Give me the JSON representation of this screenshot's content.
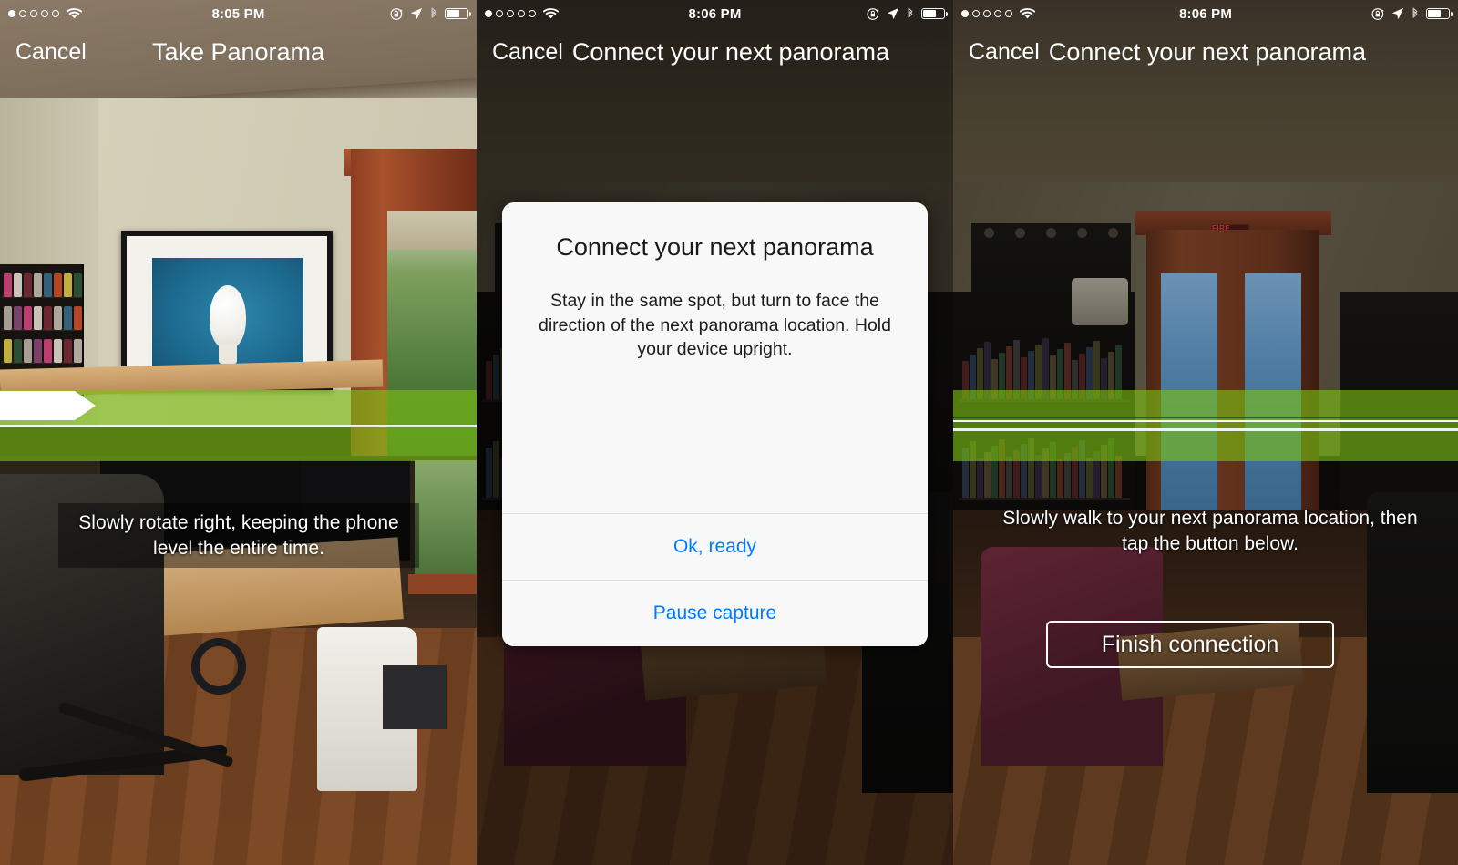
{
  "panels": [
    {
      "id": "take-panorama",
      "status": {
        "signal_filled": 1,
        "signal_total": 5,
        "wifi": "wifi-icon",
        "time": "8:05 PM",
        "rotation_lock": "rotation-lock-icon",
        "location": "location-arrow-icon",
        "bluetooth": "bluetooth-icon",
        "battery_percent": 62
      },
      "nav": {
        "cancel": "Cancel",
        "title": "Take Panorama"
      },
      "caption": "Slowly rotate right, keeping the phone level the entire time.",
      "capture_band": {
        "color": "#7cc214",
        "progress_arrow": true,
        "progress_percent": 20
      }
    },
    {
      "id": "connect-next-panorama-dialog",
      "status": {
        "signal_filled": 1,
        "signal_total": 5,
        "wifi": "wifi-icon",
        "time": "8:06 PM",
        "rotation_lock": "rotation-lock-icon",
        "location": "location-arrow-icon",
        "bluetooth": "bluetooth-icon",
        "battery_percent": 62
      },
      "nav": {
        "cancel": "Cancel",
        "title": "Connect your next panorama"
      },
      "dialog": {
        "title": "Connect your next panorama",
        "message": "Stay in the same spot, but turn to face the direction of the next panorama location. Hold your device upright.",
        "buttons": [
          {
            "label": "Ok, ready",
            "style": "primary"
          },
          {
            "label": "Pause capture",
            "style": "primary"
          }
        ]
      }
    },
    {
      "id": "connect-next-panorama-walk",
      "status": {
        "signal_filled": 1,
        "signal_total": 5,
        "wifi": "wifi-icon",
        "time": "8:06 PM",
        "rotation_lock": "rotation-lock-icon",
        "location": "location-arrow-icon",
        "bluetooth": "bluetooth-icon",
        "battery_percent": 62
      },
      "nav": {
        "cancel": "Cancel",
        "title": "Connect your next panorama"
      },
      "caption": "Slowly walk to your next panorama location, then tap the button below.",
      "button": "Finish connection",
      "capture_band": {
        "color": "#7cc214",
        "progress_arrow": false,
        "progress_percent": 100
      }
    }
  ],
  "scene": {
    "exit_sign": "FIRE EXIT"
  },
  "colors": {
    "accent_blue": "#007aff",
    "capture_green": "#7cc214",
    "dialog_bg": "#f8f8f8",
    "nav_text": "#ffffff"
  }
}
